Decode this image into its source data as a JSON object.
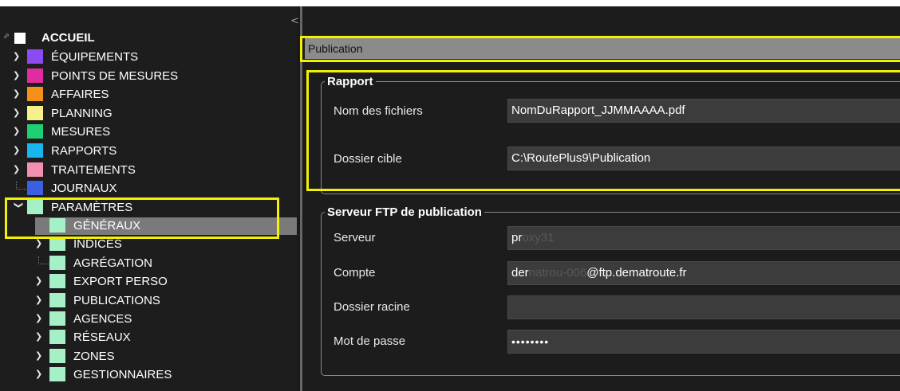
{
  "sidebar": {
    "collapse_glyph": "<",
    "root_expander": "⬀",
    "root": {
      "label": "ACCUEIL",
      "color": "#ffffff"
    },
    "items": [
      {
        "label": "ÉQUIPEMENTS",
        "color": "#8a4cf0",
        "expander": "❯",
        "icon": "chevron-right-icon"
      },
      {
        "label": "POINTS DE MESURES",
        "color": "#e02ca0",
        "expander": "❯",
        "icon": "chevron-right-icon"
      },
      {
        "label": "AFFAIRES",
        "color": "#f59118",
        "expander": "❯",
        "icon": "chevron-right-icon"
      },
      {
        "label": "PLANNING",
        "color": "#f5f08a",
        "expander": "❯",
        "icon": "chevron-right-icon"
      },
      {
        "label": "MESURES",
        "color": "#1fcf74",
        "expander": "❯",
        "icon": "chevron-right-icon"
      },
      {
        "label": "RAPPORTS",
        "color": "#19b6ee",
        "expander": "❯",
        "icon": "chevron-right-icon"
      },
      {
        "label": "TRAITEMENTS",
        "color": "#f48fb0",
        "expander": "❯",
        "icon": "chevron-right-icon"
      },
      {
        "label": "JOURNAUX",
        "color": "#3a5fe0",
        "expander": "",
        "icon": "tree-line-icon"
      },
      {
        "label": "PARAMÈTRES",
        "color": "#a6f0c8",
        "expander": "❯",
        "icon": "chevron-down-icon"
      }
    ],
    "children": [
      {
        "label": "GÉNÉRAUX",
        "color": "#a6f0c8",
        "expander": "",
        "selected": true
      },
      {
        "label": "INDICES",
        "color": "#a6f0c8",
        "expander": "❯"
      },
      {
        "label": "AGRÉGATION",
        "color": "#a6f0c8",
        "expander": ""
      },
      {
        "label": "EXPORT PERSO",
        "color": "#a6f0c8",
        "expander": "❯"
      },
      {
        "label": "PUBLICATIONS",
        "color": "#a6f0c8",
        "expander": "❯"
      },
      {
        "label": "AGENCES",
        "color": "#a6f0c8",
        "expander": "❯"
      },
      {
        "label": "RÉSEAUX",
        "color": "#a6f0c8",
        "expander": "❯"
      },
      {
        "label": "ZONES",
        "color": "#a6f0c8",
        "expander": "❯"
      },
      {
        "label": "GESTIONNAIRES",
        "color": "#a6f0c8",
        "expander": "❯"
      }
    ]
  },
  "main": {
    "section_title": "Publication",
    "rapport": {
      "legend": "Rapport",
      "fields": [
        {
          "label": "Nom des fichiers",
          "value": "NomDuRapport_JJMMAAAA.pdf"
        },
        {
          "label": "Dossier cible",
          "value": "C:\\RoutePlus9\\Publication"
        }
      ]
    },
    "ftp": {
      "legend": "Serveur FTP de publication",
      "serveur": {
        "label": "Serveur",
        "value": "pr",
        "value_faint": "oxy31"
      },
      "compte": {
        "label": "Compte",
        "value": "der",
        "value_faint": "natrou-006",
        "value_suffix": "@ftp.dematroute.fr"
      },
      "dossier": {
        "label": "Dossier racine",
        "value": ""
      },
      "password": {
        "label": "Mot de passe",
        "value": "••••••••"
      }
    }
  },
  "colors": {
    "highlight": "#f2f200",
    "header_bar": "#8b8b8b",
    "selected_row": "#7a7a7a",
    "background": "#1c1c1c"
  }
}
